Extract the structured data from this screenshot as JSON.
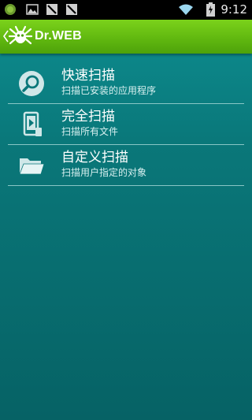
{
  "status_bar": {
    "time": "9:12",
    "icons": [
      "android-icon",
      "image-icon",
      "no-signal-icon",
      "no-signal-icon",
      "wifi-icon",
      "battery-charging-icon"
    ]
  },
  "action_bar": {
    "title": "Dr.WEB"
  },
  "menu": {
    "items": [
      {
        "title": "快速扫描",
        "subtitle": "扫描已安装的应用程序",
        "icon": "magnifier-icon"
      },
      {
        "title": "完全扫描",
        "subtitle": "扫描所有文件",
        "icon": "phone-scan-icon"
      },
      {
        "title": "自定义扫描",
        "subtitle": "扫描用户指定的对象",
        "icon": "folder-icon"
      }
    ]
  },
  "colors": {
    "action_bar": "#66bb10",
    "background": "#0a7779",
    "divider": "#9fd4d4"
  }
}
